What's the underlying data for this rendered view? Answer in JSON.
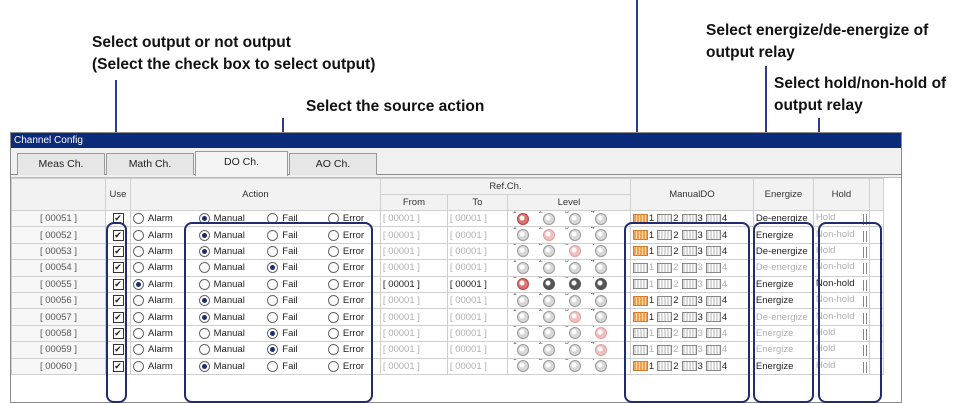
{
  "annotations": {
    "output_select_line1": "Select output or not output",
    "output_select_line2": "(Select the check box to select output)",
    "source_action": "Select the source action",
    "energize_line1": "Select energize/de-energize of",
    "energize_line2": "output relay",
    "hold_line1": "Select hold/non-hold of",
    "hold_line2": "output relay"
  },
  "window": {
    "title": "Channel Config"
  },
  "tabs": [
    {
      "label": "Meas Ch.",
      "active": false
    },
    {
      "label": "Math Ch.",
      "active": false
    },
    {
      "label": "DO Ch.",
      "active": true
    },
    {
      "label": "AO Ch.",
      "active": false
    }
  ],
  "headers": {
    "use": "Use",
    "action": "Action",
    "refch": "Ref.Ch.",
    "from": "From",
    "to": "To",
    "level": "Level",
    "manualdo": "ManualDO",
    "energize": "Energize",
    "hold": "Hold"
  },
  "action_labels": {
    "alarm": "Alarm",
    "manual": "Manual",
    "fail": "Fail",
    "error": "Error"
  },
  "manualdo_labels": [
    "1",
    "2",
    "3",
    "4"
  ],
  "rows": [
    {
      "ch": "[ 00051 ]",
      "use": true,
      "action": "manual",
      "from": "[ 00001 ]",
      "to": "[ 00001 ]",
      "energize": "De-energize",
      "hold": "Hold"
    },
    {
      "ch": "[ 00052 ]",
      "use": true,
      "action": "manual",
      "from": "[ 00001 ]",
      "to": "[ 00001 ]",
      "energize": "Energize",
      "hold": "Non-hold"
    },
    {
      "ch": "[ 00053 ]",
      "use": true,
      "action": "manual",
      "from": "[ 00001 ]",
      "to": "[ 00001 ]",
      "energize": "De-energize",
      "hold": "Hold"
    },
    {
      "ch": "[ 00054 ]",
      "use": true,
      "action": "fail",
      "from": "[ 00001 ]",
      "to": "[ 00001 ]",
      "energize": "De-energize",
      "hold": "Non-hold"
    },
    {
      "ch": "[ 00055 ]",
      "use": true,
      "action": "alarm",
      "from": "[ 00001 ]",
      "to": "[ 00001 ]",
      "energize": "Energize",
      "hold": "Non-hold"
    },
    {
      "ch": "[ 00056 ]",
      "use": true,
      "action": "manual",
      "from": "[ 00001 ]",
      "to": "[ 00001 ]",
      "energize": "Energize",
      "hold": "Non-hold"
    },
    {
      "ch": "[ 00057 ]",
      "use": true,
      "action": "manual",
      "from": "[ 00001 ]",
      "to": "[ 00001 ]",
      "energize": "De-energize",
      "hold": "Non-hold"
    },
    {
      "ch": "[ 00058 ]",
      "use": true,
      "action": "fail",
      "from": "[ 00001 ]",
      "to": "[ 00001 ]",
      "energize": "Energize",
      "hold": "Hold"
    },
    {
      "ch": "[ 00059 ]",
      "use": true,
      "action": "fail",
      "from": "[ 00001 ]",
      "to": "[ 00001 ]",
      "energize": "Energize",
      "hold": "Hold"
    },
    {
      "ch": "[ 00060 ]",
      "use": true,
      "action": "manual",
      "from": "[ 00001 ]",
      "to": "[ 00001 ]",
      "energize": "Energize",
      "hold": "Hold"
    }
  ]
}
